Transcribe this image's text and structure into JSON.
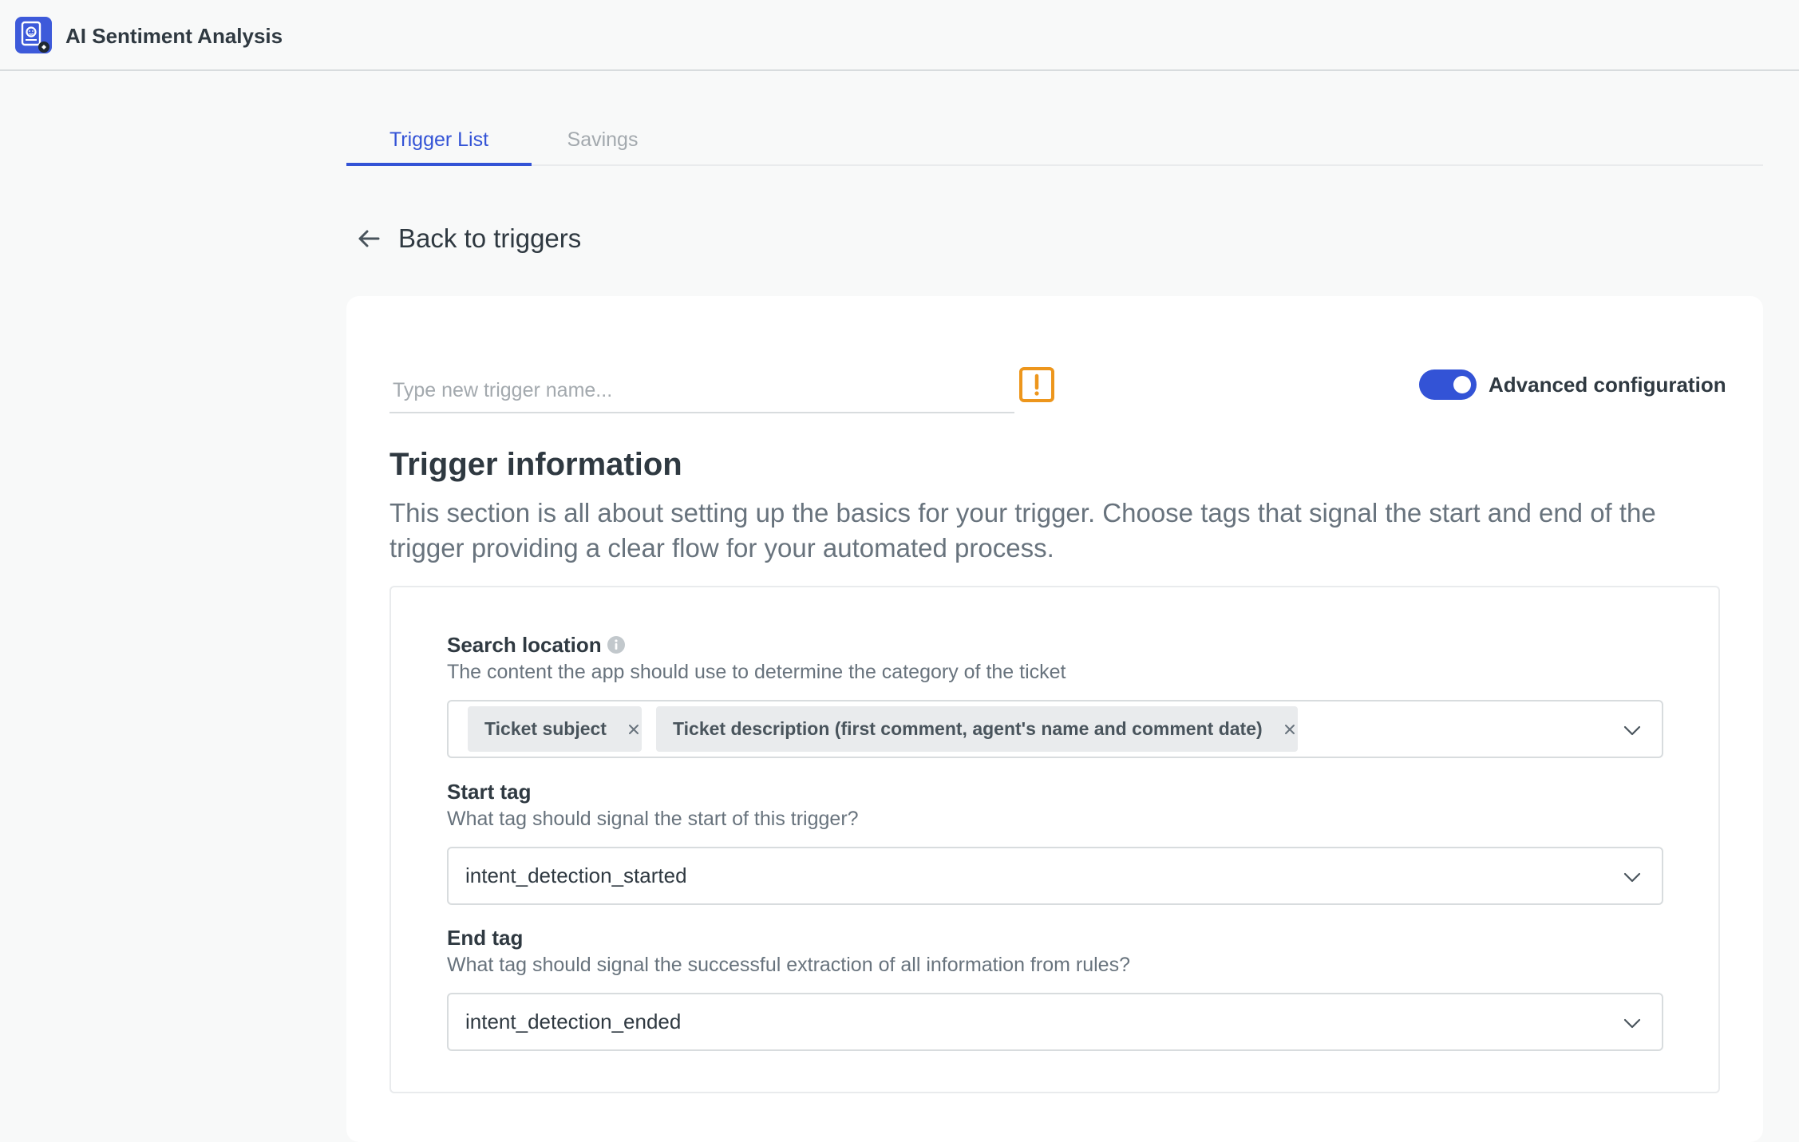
{
  "app": {
    "title": "AI Sentiment Analysis"
  },
  "tabs": [
    {
      "label": "Trigger List",
      "active": true
    },
    {
      "label": "Savings",
      "active": false
    }
  ],
  "back_link": {
    "label": "Back to triggers",
    "icon": "arrow-left-icon"
  },
  "trigger_form": {
    "name_value": "",
    "name_placeholder": "Type new trigger name...",
    "warning_icon": "exclamation-square-icon",
    "advanced_toggle": {
      "label": "Advanced configuration",
      "on": true
    },
    "section_title": "Trigger information",
    "section_description": "This section is all about setting up the basics for your trigger. Choose tags that signal the start and end of the trigger providing a clear flow for your automated process.",
    "search_location": {
      "label": "Search location",
      "hint": "The content the app should use to determine the category of the ticket",
      "chips": [
        "Ticket subject",
        "Ticket description (first comment, agent's name and comment date)"
      ]
    },
    "start_tag": {
      "label": "Start tag",
      "hint": "What tag should signal the start of this trigger?",
      "value": "intent_detection_started"
    },
    "end_tag": {
      "label": "End tag",
      "hint": "What tag should signal the successful extraction of all information from rules?",
      "value": "intent_detection_ended"
    }
  },
  "colors": {
    "accent": "#3353d6",
    "warning": "#ed961c",
    "text_primary": "#2f3941",
    "text_secondary": "#68737d",
    "chip_bg": "#e9ebed"
  }
}
